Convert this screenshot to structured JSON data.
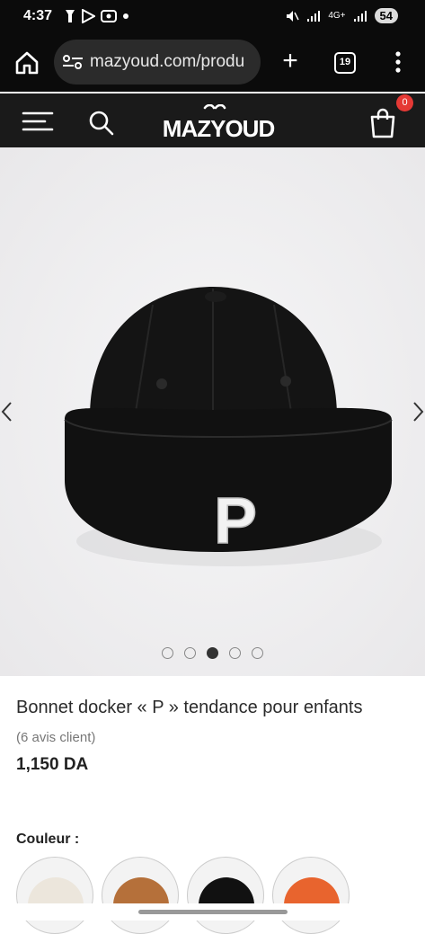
{
  "status": {
    "time": "4:37",
    "network": "4G+",
    "battery": "54"
  },
  "browser": {
    "url": "mazyoud.com/produ",
    "tab_count": "19"
  },
  "site": {
    "logo": "MAZYOUD",
    "cart_count": "0"
  },
  "gallery": {
    "image_count": 5,
    "active_index": 2,
    "print_letter": "P"
  },
  "product": {
    "title": "Bonnet docker « P » tendance pour enfants",
    "reviews": "(6 avis client)",
    "price": "1,150 DA"
  },
  "options": {
    "color_label": "Couleur :",
    "colors": [
      "#ece6dc",
      "#b5703a",
      "#111111",
      "#e8642e"
    ]
  }
}
